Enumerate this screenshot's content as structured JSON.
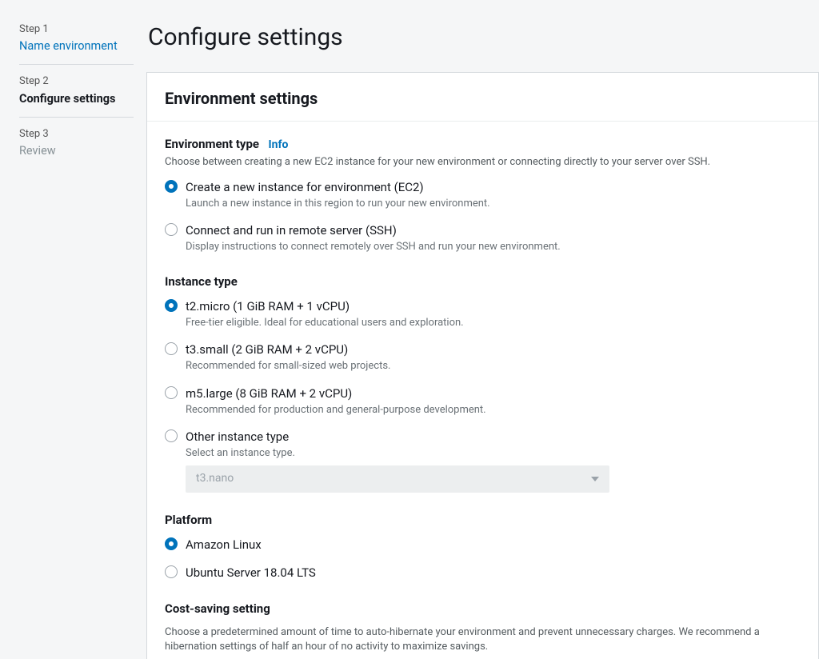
{
  "sidebar": {
    "steps": [
      {
        "label": "Step 1",
        "name": "Name environment",
        "state": "link"
      },
      {
        "label": "Step 2",
        "name": "Configure settings",
        "state": "active"
      },
      {
        "label": "Step 3",
        "name": "Review",
        "state": "dim"
      }
    ]
  },
  "page": {
    "title": "Configure settings"
  },
  "panel": {
    "title": "Environment settings",
    "env_type": {
      "title": "Environment type",
      "info": "Info",
      "desc": "Choose between creating a new EC2 instance for your new environment or connecting directly to your server over SSH.",
      "options": [
        {
          "label": "Create a new instance for environment (EC2)",
          "desc": "Launch a new instance in this region to run your new environment.",
          "selected": true
        },
        {
          "label": "Connect and run in remote server (SSH)",
          "desc": "Display instructions to connect remotely over SSH and run your new environment.",
          "selected": false
        }
      ]
    },
    "instance_type": {
      "title": "Instance type",
      "options": [
        {
          "label": "t2.micro (1 GiB RAM + 1 vCPU)",
          "desc": "Free-tier eligible. Ideal for educational users and exploration.",
          "selected": true
        },
        {
          "label": "t3.small (2 GiB RAM + 2 vCPU)",
          "desc": "Recommended for small-sized web projects.",
          "selected": false
        },
        {
          "label": "m5.large (8 GiB RAM + 2 vCPU)",
          "desc": "Recommended for production and general-purpose development.",
          "selected": false
        },
        {
          "label": "Other instance type",
          "desc": "Select an instance type.",
          "selected": false
        }
      ],
      "other_select": "t3.nano"
    },
    "platform": {
      "title": "Platform",
      "options": [
        {
          "label": "Amazon Linux",
          "selected": true
        },
        {
          "label": "Ubuntu Server 18.04 LTS",
          "selected": false
        }
      ]
    },
    "cost_saving": {
      "title": "Cost-saving setting",
      "desc": "Choose a predetermined amount of time to auto-hibernate your environment and prevent unnecessary charges. We recommend a hibernation settings of half an hour of no activity to maximize savings."
    }
  }
}
